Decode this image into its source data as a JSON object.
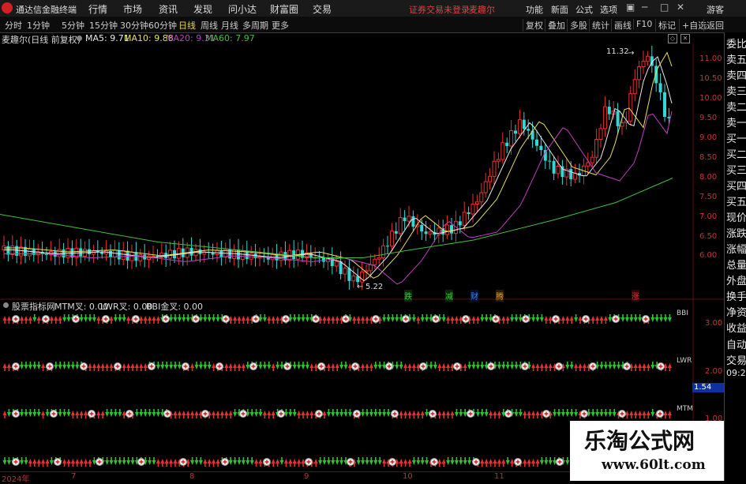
{
  "menubar": {
    "app_title": "通达信金融终端",
    "menus": [
      "行情",
      "市场",
      "资讯",
      "发现",
      "问小达",
      "财富圈",
      "交易"
    ],
    "notice": "证券交易未登录",
    "stock_name": "麦趣尔",
    "right_menus": [
      "功能",
      "新面",
      "公式",
      "选项"
    ],
    "guest": "游客"
  },
  "toolbar": {
    "periods": [
      "分时",
      "1分钟",
      "5分钟",
      "15分钟",
      "30分钟",
      "60分钟",
      "日线",
      "周线",
      "月线",
      "多周期",
      "更多"
    ],
    "active_period": "日线",
    "right_buttons": [
      "复权",
      "叠加",
      "多股",
      "统计",
      "画线",
      "F10",
      "标记",
      "+自选",
      "返回"
    ]
  },
  "chart_header": {
    "title": "麦趣尔(日线 前复权)",
    "ma5": "MA5: 9.71",
    "ma10": "MA10: 9.88",
    "ma20": "MA20: 9.31",
    "ma60": "MA60: 7.97"
  },
  "price_axis": [
    "11.00",
    "10.50",
    "10.00",
    "9.50",
    "9.00",
    "8.50",
    "8.00",
    "7.50",
    "7.00",
    "6.50",
    "6.00"
  ],
  "annotations": {
    "high": "11.32",
    "low": "5.22",
    "markers": [
      "跌",
      "减",
      "财",
      "腾",
      "涨"
    ]
  },
  "indicator": {
    "title": "股票指标网",
    "mtm": "MTM叉: 0.00",
    "lwr": "LWR叉: 0.00",
    "bbi": "BBI金叉: 0.00",
    "row_labels": [
      "BBI",
      "LWR",
      "MTM"
    ],
    "axis": [
      "3.00",
      "2.00",
      "1.00"
    ],
    "cursor_value": "1.54"
  },
  "sidebar": [
    "委比",
    "卖五",
    "卖四",
    "卖三",
    "卖二",
    "卖一",
    "买一",
    "买二",
    "买三",
    "买四",
    "买五",
    "现价",
    "涨跌",
    "涨幅",
    "总量",
    "外盘",
    "换手",
    "净资",
    "收益",
    "自动",
    "交易"
  ],
  "sidebar_time": "09:25",
  "date_axis": [
    "2024年",
    "7",
    "8",
    "9",
    "10",
    "11"
  ],
  "watermark": {
    "title": "乐淘公式网",
    "url": "www.60lt.com"
  },
  "colors": {
    "up": "#e83030",
    "down": "#30d8d8",
    "ma5": "#e8e8e8",
    "ma10": "#e8e060",
    "ma20": "#c040c0",
    "ma60": "#40c040",
    "arrow_up": "#e83030",
    "arrow_down": "#30c030"
  },
  "chart_data": {
    "type": "candlestick",
    "title": "麦趣尔(日线 前复权)",
    "price_range": [
      5.22,
      11.32
    ],
    "ma": {
      "MA5": 9.71,
      "MA10": 9.88,
      "MA20": 9.31,
      "MA60": 7.97
    },
    "x_labels": [
      "2024年",
      "7",
      "8",
      "9",
      "10",
      "11"
    ]
  }
}
